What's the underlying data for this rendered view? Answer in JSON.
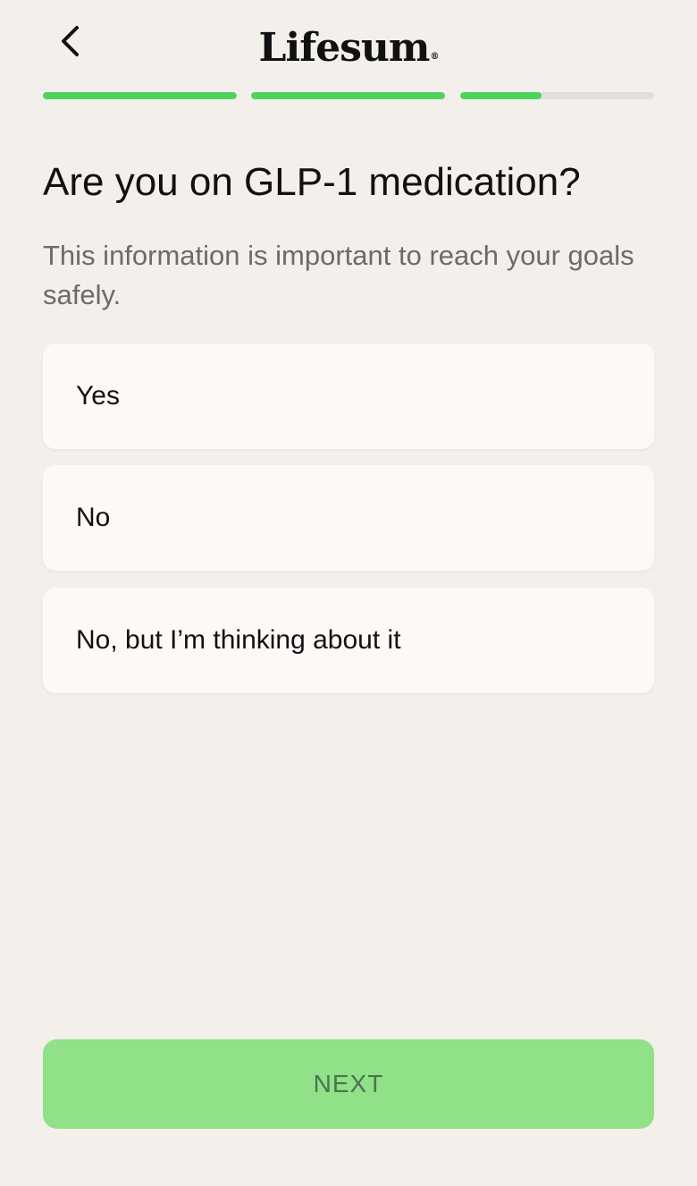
{
  "header": {
    "back_icon": "chevron-left-icon",
    "logo_text": "Lifesum",
    "logo_mark": "®"
  },
  "progress": {
    "segments": [
      {
        "fill": 1.0
      },
      {
        "fill": 1.0
      },
      {
        "fill": 0.42
      }
    ],
    "active_color": "#4cd45f",
    "track_color": "#e3ded9"
  },
  "question": {
    "title": "Are you on GLP-1 medication?",
    "subtitle": "This information is important to reach your goals safely."
  },
  "options": [
    {
      "label": "Yes"
    },
    {
      "label": "No"
    },
    {
      "label": "No, but I’m thinking about it"
    }
  ],
  "footer": {
    "next_label": "NEXT",
    "next_bg": "#90e188",
    "next_text_color": "#4c7352"
  }
}
